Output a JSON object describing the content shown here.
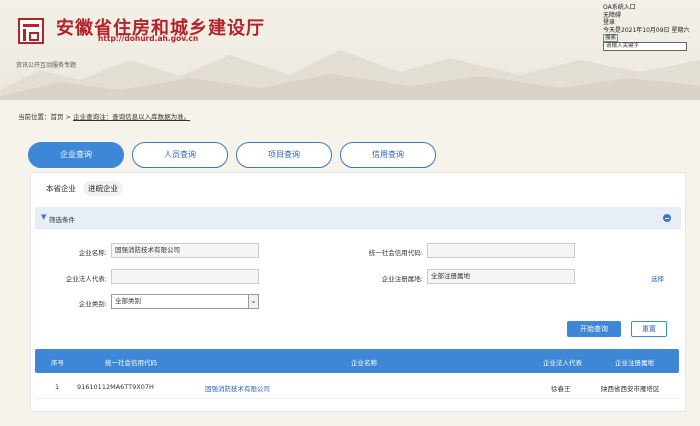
{
  "header": {
    "title": "安徽省住房和城乡建设厅",
    "url": "http://dohurd.ah.gov.cn",
    "service_tag": "资讯公开互动服务专题",
    "top_right": {
      "oa": "OA系统入口",
      "accessible": "无障碍",
      "login": "登录",
      "date": "今天是2021年10月09日 星期六",
      "search_btn": "搜索",
      "search_placeholder": "请输入关键字"
    }
  },
  "breadcrumb": {
    "prefix": "当前位置：",
    "home": "首页",
    "sep": " > ",
    "current": "企业查询",
    "note": "注：查询信息以入库数据为准。"
  },
  "tabs": [
    "企业查询",
    "人员查询",
    "项目查询",
    "信用查询"
  ],
  "subtabs": [
    "本省企业",
    "进皖企业"
  ],
  "filter": {
    "title": "筛选条件",
    "company_name_label": "企业名称:",
    "company_name_value": "固强消防技术有限公司",
    "credit_code_label": "统一社会信用代码:",
    "credit_code_value": "",
    "legal_rep_label": "企业法人代表:",
    "legal_rep_value": "",
    "region_label": "企业注册属地:",
    "region_value": "全部注册属地",
    "select_link": "选择",
    "category_label": "企业类别:",
    "category_value": "全部类别",
    "search_button": "开始查询",
    "reset_button": "重置"
  },
  "table": {
    "headers": [
      "序号",
      "统一社会信用代码",
      "企业名称",
      "企业法人代表",
      "企业注册属地"
    ],
    "rows": [
      [
        "1",
        "91610112MA6TT9X07H",
        "固强消防技术有限公司",
        "徐春王",
        "陕西省西安市雁塔区"
      ]
    ]
  },
  "colors": {
    "brand_red": "#b3232a",
    "accent_blue": "#3e86d6"
  }
}
